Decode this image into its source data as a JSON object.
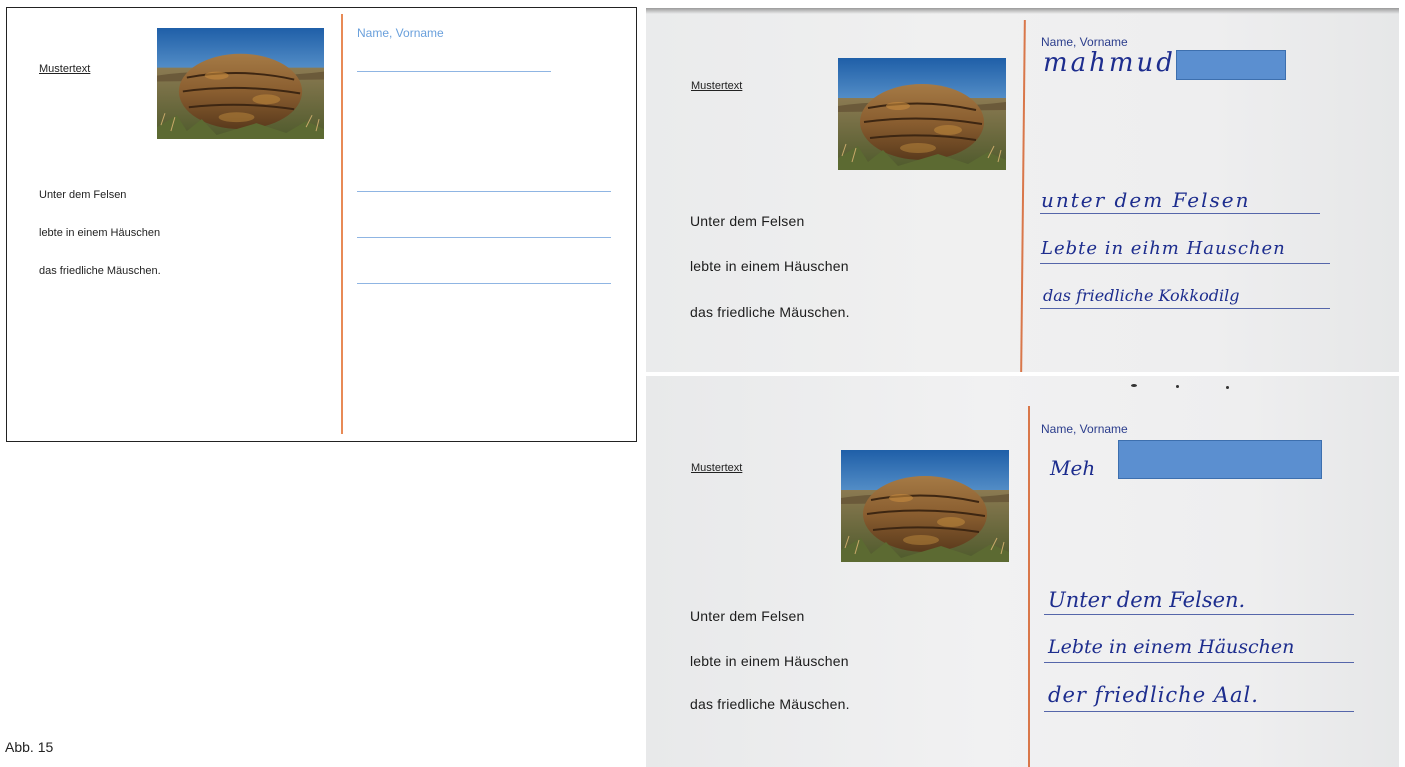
{
  "template_card": {
    "title": "Mustertext",
    "lines": [
      "Unter dem Felsen",
      "lebte in einem Häuschen",
      "das friedliche Mäuschen."
    ],
    "name_label": "Name, Vorname"
  },
  "photo_card_1": {
    "title": "Mustertext",
    "lines": [
      "Unter dem Felsen",
      "lebte in einem Häuschen",
      "das friedliche Mäuschen."
    ],
    "name_label": "Name, Vorname",
    "handwritten_name": "mahmud",
    "handwritten_lines": [
      "unter dem Felsen",
      "Lebte in eihm Hauschen",
      "das friedliche Kokkodilg"
    ]
  },
  "photo_card_2": {
    "title": "Mustertext",
    "lines": [
      "Unter dem Felsen",
      "lebte in einem Häuschen",
      "das friedliche Mäuschen."
    ],
    "name_label": "Name, Vorname",
    "handwritten_name": "Meh",
    "handwritten_lines": [
      "Unter dem Felsen.",
      "Lebte in einem Häuschen",
      "der friedliche Aal."
    ]
  },
  "caption": "Abb. 15",
  "colors": {
    "divider": "#e88a56",
    "template_name_label": "#6aa0dc",
    "writing_line": "#8fb5e3",
    "handwriting": "#1d2d8e",
    "redaction": "#5b8fd0"
  },
  "icons": [
    "rock-photo"
  ]
}
